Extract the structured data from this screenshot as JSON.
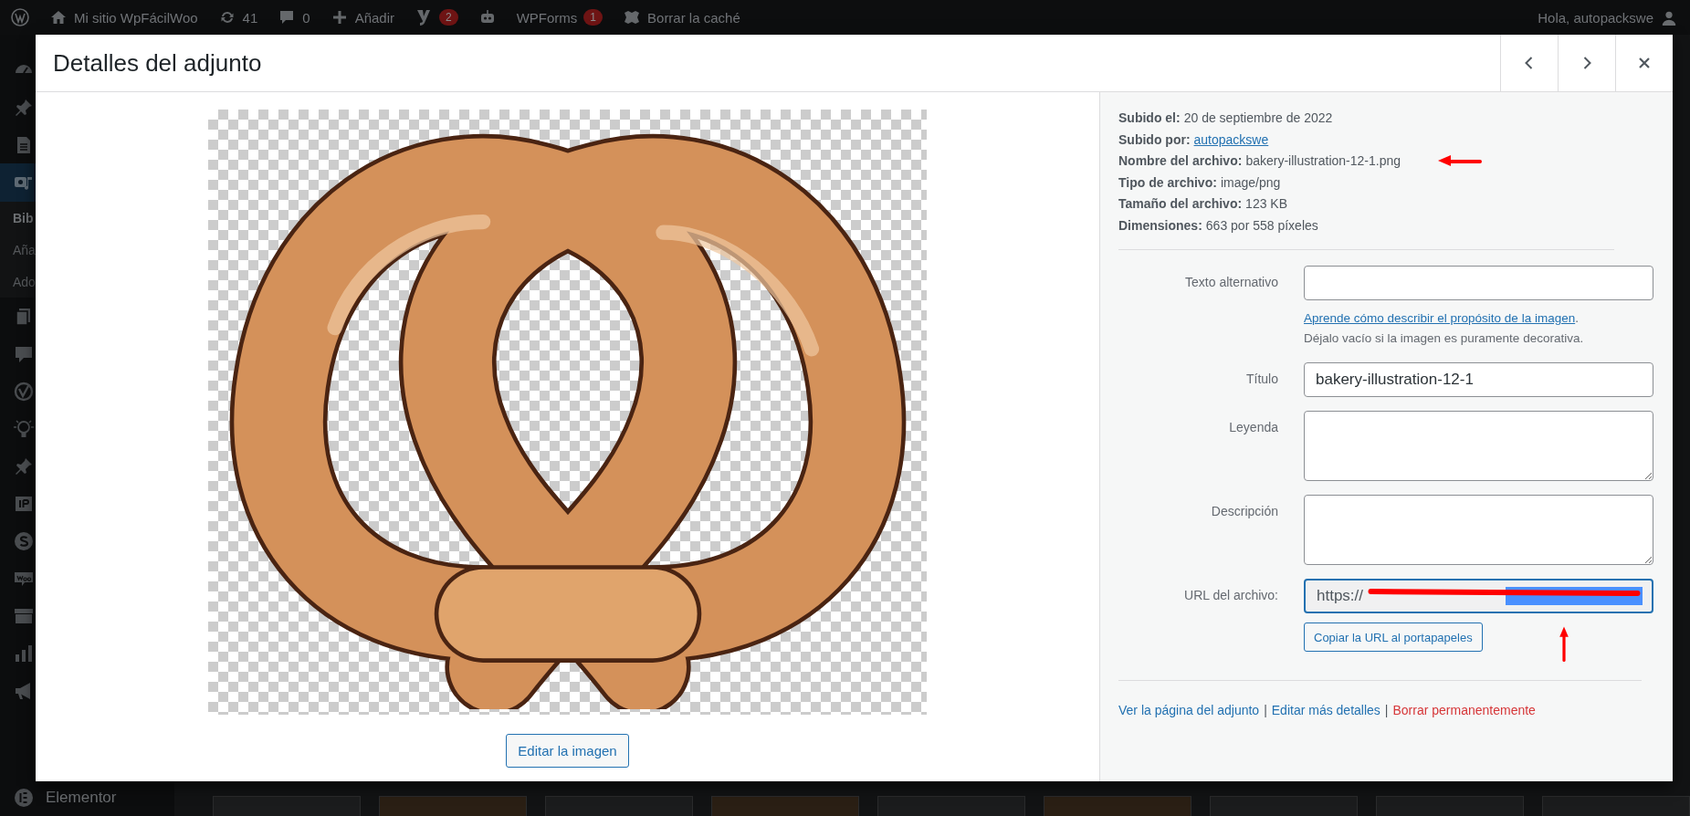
{
  "admin_bar": {
    "items": [
      {
        "kind": "wp-logo"
      },
      {
        "kind": "home",
        "label": "Mi sitio WpFácilWoo"
      },
      {
        "kind": "updates",
        "label": "41"
      },
      {
        "kind": "comments",
        "label": "0"
      },
      {
        "kind": "new",
        "label": "Añadir"
      },
      {
        "kind": "yoast",
        "badge": "2"
      },
      {
        "kind": "robot"
      },
      {
        "kind": "wpforms",
        "label": "WPForms",
        "badge": "1"
      },
      {
        "kind": "cache",
        "label": "Borrar la caché"
      }
    ],
    "greeting": "Hola, autopackswe"
  },
  "sidebar": {
    "items": [
      {
        "kind": "dashboard",
        "selected": false
      },
      {
        "kind": "pin",
        "selected": false
      },
      {
        "kind": "document",
        "selected": false
      },
      {
        "kind": "media",
        "selected": true
      },
      {
        "kind": "submenu",
        "label": "Bib",
        "selected": true
      },
      {
        "kind": "submenu",
        "label": "Aña",
        "selected": false
      },
      {
        "kind": "submenu",
        "label": "Ado",
        "selected": false
      },
      {
        "kind": "pages",
        "selected": false
      },
      {
        "kind": "comment",
        "selected": false
      },
      {
        "kind": "check",
        "selected": false
      },
      {
        "kind": "bulb",
        "selected": false
      },
      {
        "kind": "pin",
        "selected": false
      },
      {
        "kind": "ip",
        "selected": false
      },
      {
        "kind": "s",
        "selected": false
      },
      {
        "kind": "woo",
        "selected": false
      },
      {
        "kind": "archive",
        "selected": false
      },
      {
        "kind": "chart",
        "selected": false
      },
      {
        "kind": "megaphone",
        "selected": false
      },
      {
        "kind": "elementor",
        "label": "Elementor",
        "selected": false
      }
    ]
  },
  "modal": {
    "title": "Detalles del adjunto",
    "edit_image_button": "Editar la imagen",
    "details": [
      {
        "kind": "text",
        "label": "Subido el:",
        "value": "20 de septiembre de 2022"
      },
      {
        "kind": "link",
        "label": "Subido por:",
        "value": "autopackswe"
      },
      {
        "kind": "text",
        "label": "Nombre del archivo:",
        "value": "bakery-illustration-12-1.png"
      },
      {
        "kind": "text",
        "label": "Tipo de archivo:",
        "value": "image/png"
      },
      {
        "kind": "text",
        "label": "Tamaño del archivo:",
        "value": "123 KB"
      },
      {
        "kind": "text",
        "label": "Dimensiones:",
        "value": "663 por 558 píxeles"
      }
    ],
    "fields": [
      {
        "kind": "input",
        "label": "Texto alternativo",
        "help_link": "Aprende cómo describir el propósito de la imagen",
        "help_after": ".",
        "help_note": "Déjalo vacío si la imagen es puramente decorativa."
      },
      {
        "kind": "input",
        "label": "Título",
        "value": "bakery-illustration-12-1"
      },
      {
        "kind": "textarea",
        "label": "Leyenda"
      },
      {
        "kind": "textarea",
        "label": "Descripción"
      },
      {
        "kind": "url",
        "label": "URL del archivo:",
        "value": "https://",
        "button": "Copiar la URL al portapapeles"
      }
    ],
    "actions": [
      {
        "kind": "link",
        "label": "Ver la página del adjunto"
      },
      {
        "kind": "link",
        "label": "Editar más detalles"
      },
      {
        "kind": "delete",
        "label": "Borrar permanentemente"
      }
    ],
    "separator": "|"
  }
}
